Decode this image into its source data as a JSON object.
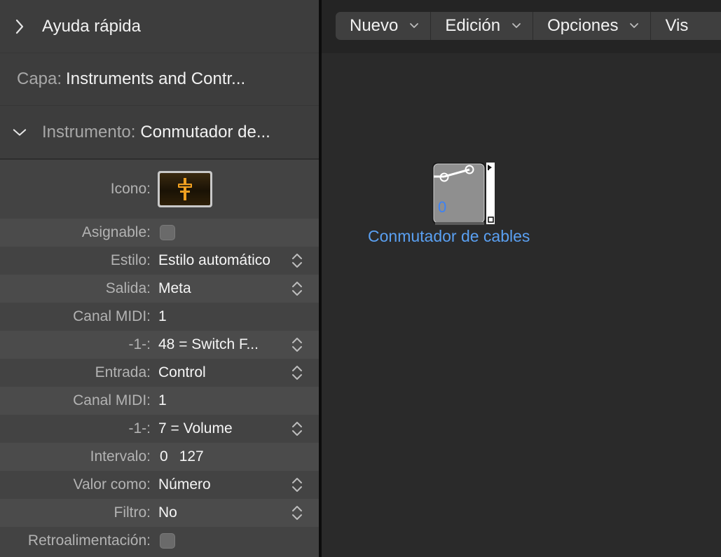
{
  "inspector": {
    "quick_help": "Ayuda rápida",
    "layer_label": "Capa:",
    "layer_value": "Instruments and Contr...",
    "instrument_label": "Instrumento:",
    "instrument_value": "Conmutador de...",
    "params": {
      "icon_label": "Icono:",
      "assignable_label": "Asignable:",
      "style_label": "Estilo:",
      "style_value": "Estilo automático",
      "output_label": "Salida:",
      "output_value": "Meta",
      "midi_channel_out_label": "Canal MIDI:",
      "midi_channel_out_value": "1",
      "out_controller_label": "-1-:",
      "out_controller_value": "48 = Switch F...",
      "input_label": "Entrada:",
      "input_value": "Control",
      "midi_channel_in_label": "Canal MIDI:",
      "midi_channel_in_value": "1",
      "in_controller_label": "-1-:",
      "in_controller_value": "7 = Volume",
      "range_label": "Intervalo:",
      "range_min": "0",
      "range_max": "127",
      "value_as_label": "Valor como:",
      "value_as_value": "Número",
      "filter_label": "Filtro:",
      "filter_value": "No",
      "feedback_label": "Retroalimentación:"
    }
  },
  "toolbar": {
    "menus": [
      "Nuevo",
      "Edición",
      "Opciones",
      "Vis"
    ]
  },
  "environment": {
    "object_label": "Conmutador de cables",
    "object_value": "0"
  },
  "colors": {
    "accent": "#5aa0f2",
    "panel": "#434343",
    "canvas": "#2a2a2a"
  }
}
